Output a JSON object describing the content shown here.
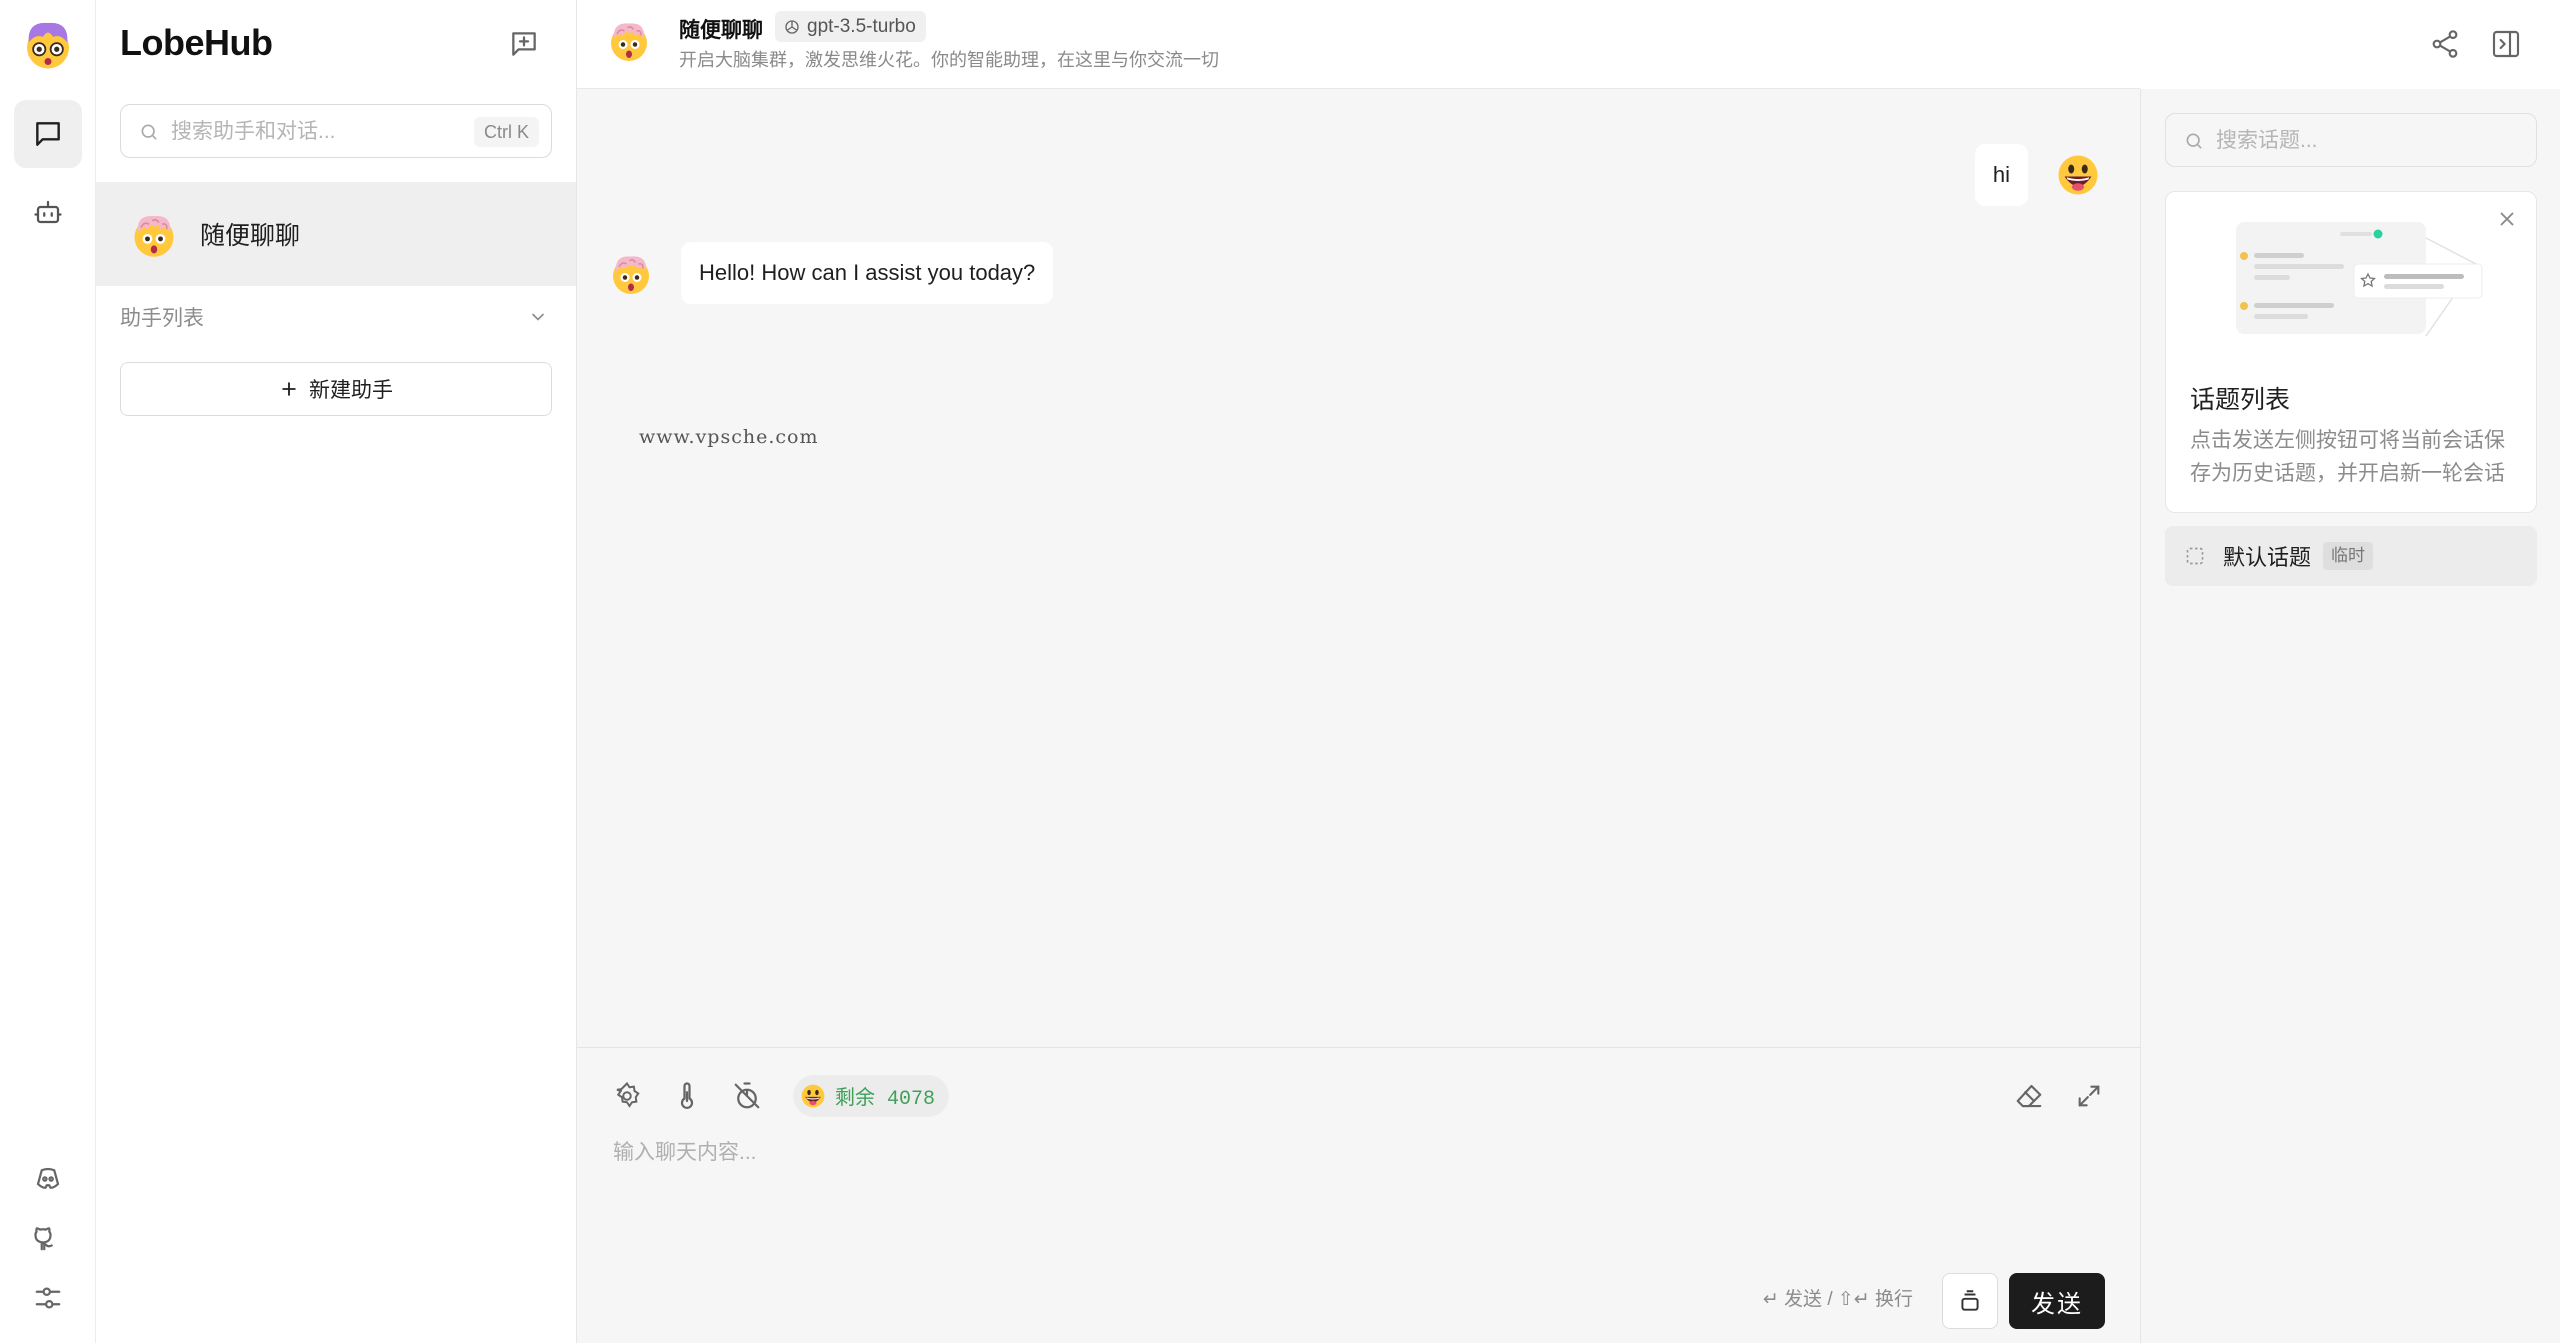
{
  "app": {
    "brand": "LobeHub"
  },
  "sidebar": {
    "search_placeholder": "搜索助手和对话...",
    "search_shortcut": "Ctrl K",
    "sessions": [
      {
        "label": "随便聊聊"
      }
    ],
    "group_label": "助手列表",
    "new_assistant_label": "新建助手"
  },
  "header": {
    "title": "随便聊聊",
    "model": "gpt-3.5-turbo",
    "description": "开启大脑集群，激发思维火花。你的智能助理，在这里与你交流一切"
  },
  "messages": [
    {
      "role": "user",
      "text": "hi"
    },
    {
      "role": "assistant",
      "text": "Hello! How can I assist you today?"
    }
  ],
  "watermark": "www.vpsche.com",
  "composer": {
    "token_label": "剩余 4078",
    "placeholder": "输入聊天内容...",
    "hint": "↵ 发送 / ⇧↵ 换行",
    "send_label": "发送"
  },
  "topics": {
    "search_placeholder": "搜索话题...",
    "guide_title": "话题列表",
    "guide_desc": "点击发送左侧按钮可将当前会话保存为历史话题，并开启新一轮会话",
    "items": [
      {
        "label": "默认话题",
        "badge": "临时"
      }
    ]
  },
  "icons": {
    "rail": [
      "chat-icon",
      "robot-icon"
    ],
    "rail_bottom": [
      "discord-icon",
      "github-icon",
      "settings-sliders-icon"
    ],
    "header": [
      "share-icon",
      "panel-toggle-icon"
    ],
    "composer_tools": [
      "settings-gear-icon",
      "thermometer-icon",
      "timer-off-icon",
      "eraser-icon",
      "expand-icon",
      "archive-icon"
    ]
  },
  "colors": {
    "accent_send": "#1c1c1c",
    "token_text": "#3fa05a",
    "active_item_bg": "#efefef"
  }
}
